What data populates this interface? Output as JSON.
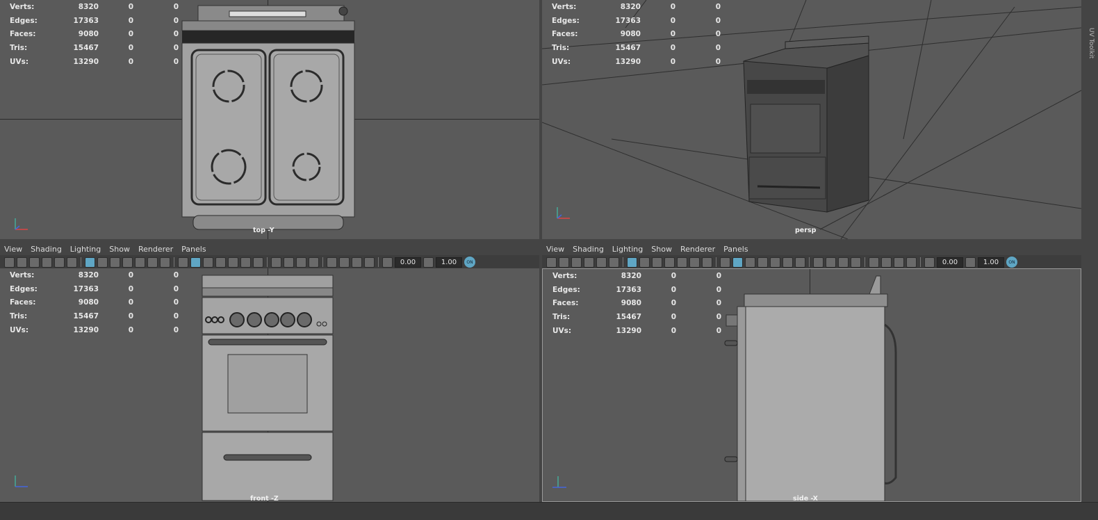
{
  "stats": [
    {
      "label": "Verts:",
      "v1": "8320",
      "v2": "0",
      "v3": "0"
    },
    {
      "label": "Edges:",
      "v1": "17363",
      "v2": "0",
      "v3": "0"
    },
    {
      "label": "Faces:",
      "v1": "9080",
      "v2": "0",
      "v3": "0"
    },
    {
      "label": "Tris:",
      "v1": "15467",
      "v2": "0",
      "v3": "0"
    },
    {
      "label": "UVs:",
      "v1": "13290",
      "v2": "0",
      "v3": "0"
    }
  ],
  "viewports": {
    "top": {
      "label": "top -Y"
    },
    "persp": {
      "label": "persp"
    },
    "front": {
      "label": "front -Z"
    },
    "side": {
      "label": "side -X"
    }
  },
  "menus": [
    "View",
    "Shading",
    "Lighting",
    "Show",
    "Renderer",
    "Panels"
  ],
  "toolbar": {
    "exposure": "0.00",
    "gamma": "1.00",
    "toggle": "ON"
  },
  "sidebar": {
    "tab": "UV Toolkit"
  },
  "colors": {
    "viewport_bg": "#5a5a5a",
    "model": "#a8a8a8",
    "accent": "#5fa6c4"
  }
}
